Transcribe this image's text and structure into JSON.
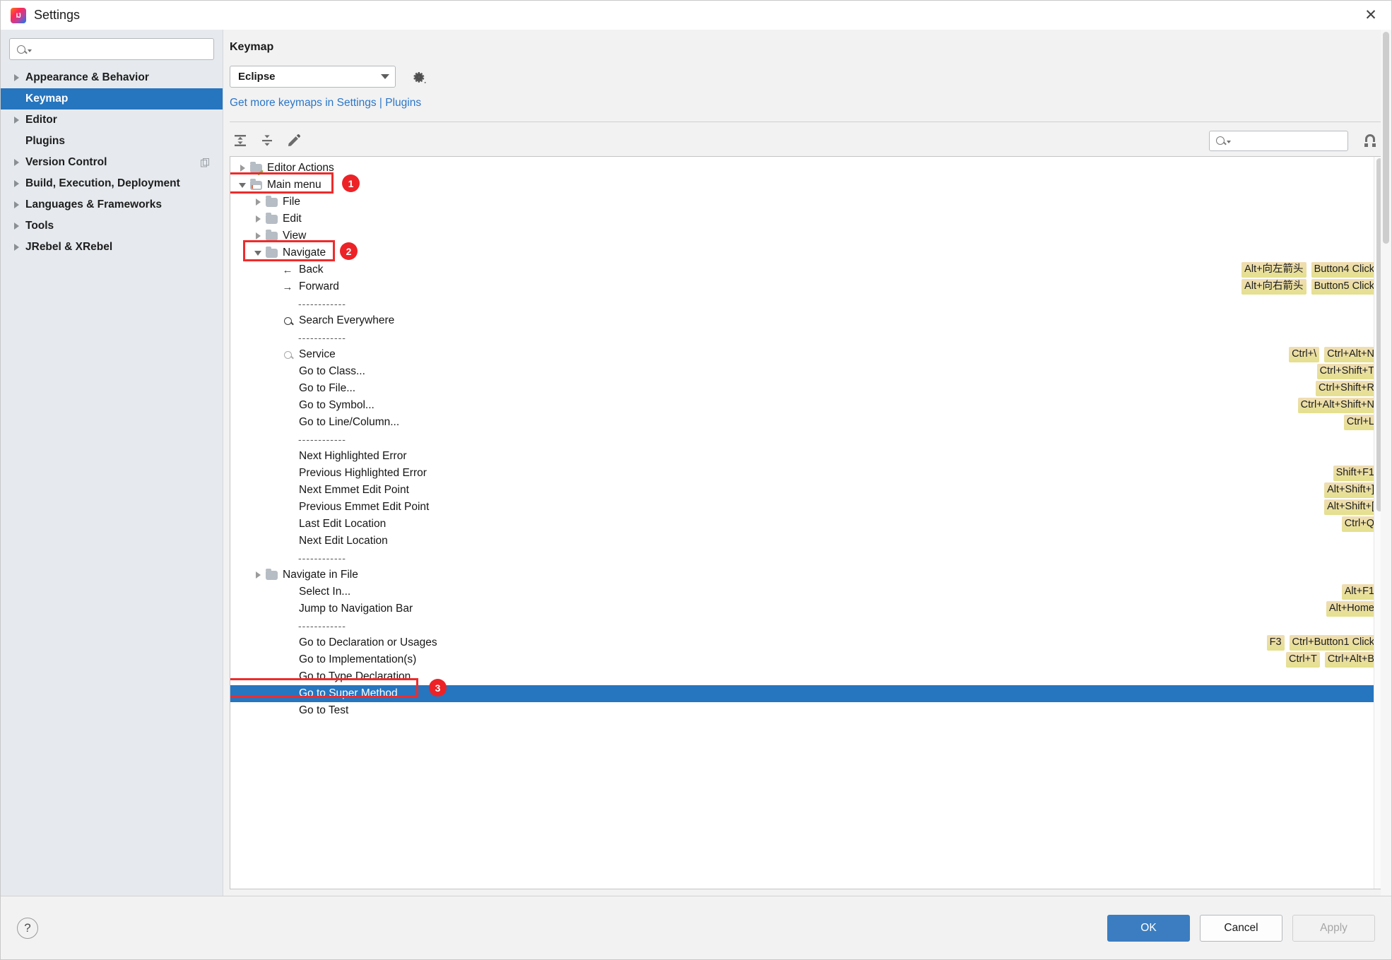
{
  "window": {
    "title": "Settings",
    "logo_icon": "intellij-idea-logo",
    "close_icon": "close-icon"
  },
  "sidebar": {
    "search": {
      "placeholder": "",
      "value": "",
      "icon": "search-icon"
    },
    "items": [
      {
        "label": "Appearance & Behavior",
        "expandable": true,
        "selected": false,
        "extra_icon": ""
      },
      {
        "label": "Keymap",
        "expandable": false,
        "selected": true,
        "extra_icon": ""
      },
      {
        "label": "Editor",
        "expandable": true,
        "selected": false,
        "extra_icon": ""
      },
      {
        "label": "Plugins",
        "expandable": false,
        "selected": false,
        "extra_icon": ""
      },
      {
        "label": "Version Control",
        "expandable": true,
        "selected": false,
        "extra_icon": "copy-icon"
      },
      {
        "label": "Build, Execution, Deployment",
        "expandable": true,
        "selected": false,
        "extra_icon": ""
      },
      {
        "label": "Languages & Frameworks",
        "expandable": true,
        "selected": false,
        "extra_icon": ""
      },
      {
        "label": "Tools",
        "expandable": true,
        "selected": false,
        "extra_icon": ""
      },
      {
        "label": "JRebel & XRebel",
        "expandable": true,
        "selected": false,
        "extra_icon": ""
      }
    ]
  },
  "main": {
    "title": "Keymap",
    "keymap_select": {
      "value": "Eclipse",
      "icon": "chevron-down-icon"
    },
    "gear_icon": "gear-icon",
    "link": "Get more keymaps in Settings | Plugins",
    "toolbar": {
      "expand_all_icon": "expand-all-icon",
      "collapse_all_icon": "collapse-all-icon",
      "edit_shortcut_icon": "pencil-edit-icon",
      "search": {
        "placeholder": "",
        "value": "",
        "icon": "search-icon"
      },
      "find_actions_by_shortcut_icon": "find-by-shortcut-icon"
    }
  },
  "tree": {
    "rows": [
      {
        "indent": 0,
        "twisty": "right",
        "icon": "folder-editor",
        "label": "Editor Actions",
        "shortcuts": []
      },
      {
        "indent": 0,
        "twisty": "down",
        "icon": "folder-mainmenu",
        "label": "Main menu",
        "shortcuts": [],
        "annotated": 1
      },
      {
        "indent": 1,
        "twisty": "right",
        "icon": "folder",
        "label": "File",
        "shortcuts": []
      },
      {
        "indent": 1,
        "twisty": "right",
        "icon": "folder",
        "label": "Edit",
        "shortcuts": []
      },
      {
        "indent": 1,
        "twisty": "right",
        "icon": "folder",
        "label": "View",
        "shortcuts": []
      },
      {
        "indent": 1,
        "twisty": "down",
        "icon": "folder",
        "label": "Navigate",
        "shortcuts": [],
        "annotated": 2
      },
      {
        "indent": 2,
        "twisty": "none",
        "icon": "arrow-left",
        "label": "Back",
        "shortcuts": [
          "Alt+向左箭头",
          "Button4 Click"
        ]
      },
      {
        "indent": 2,
        "twisty": "none",
        "icon": "arrow-right",
        "label": "Forward",
        "shortcuts": [
          "Alt+向右箭头",
          "Button5 Click"
        ]
      },
      {
        "indent": 2,
        "twisty": "none",
        "icon": "separator",
        "label": "------------",
        "shortcuts": []
      },
      {
        "indent": 2,
        "twisty": "none",
        "icon": "magnifier-dark",
        "label": "Search Everywhere",
        "shortcuts": []
      },
      {
        "indent": 2,
        "twisty": "none",
        "icon": "separator",
        "label": "------------",
        "shortcuts": []
      },
      {
        "indent": 2,
        "twisty": "none",
        "icon": "magnifier-light",
        "label": "Service",
        "shortcuts": [
          "Ctrl+\\",
          "Ctrl+Alt+N"
        ]
      },
      {
        "indent": 2,
        "twisty": "none",
        "icon": "none",
        "label": "Go to Class...",
        "shortcuts": [
          "Ctrl+Shift+T"
        ]
      },
      {
        "indent": 2,
        "twisty": "none",
        "icon": "none",
        "label": "Go to File...",
        "shortcuts": [
          "Ctrl+Shift+R"
        ]
      },
      {
        "indent": 2,
        "twisty": "none",
        "icon": "none",
        "label": "Go to Symbol...",
        "shortcuts": [
          "Ctrl+Alt+Shift+N"
        ]
      },
      {
        "indent": 2,
        "twisty": "none",
        "icon": "none",
        "label": "Go to Line/Column...",
        "shortcuts": [
          "Ctrl+L"
        ]
      },
      {
        "indent": 2,
        "twisty": "none",
        "icon": "separator",
        "label": "------------",
        "shortcuts": []
      },
      {
        "indent": 2,
        "twisty": "none",
        "icon": "none",
        "label": "Next Highlighted Error",
        "shortcuts": []
      },
      {
        "indent": 2,
        "twisty": "none",
        "icon": "none",
        "label": "Previous Highlighted Error",
        "shortcuts": [
          "Shift+F1"
        ]
      },
      {
        "indent": 2,
        "twisty": "none",
        "icon": "none",
        "label": "Next Emmet Edit Point",
        "shortcuts": [
          "Alt+Shift+]"
        ]
      },
      {
        "indent": 2,
        "twisty": "none",
        "icon": "none",
        "label": "Previous Emmet Edit Point",
        "shortcuts": [
          "Alt+Shift+["
        ]
      },
      {
        "indent": 2,
        "twisty": "none",
        "icon": "none",
        "label": "Last Edit Location",
        "shortcuts": [
          "Ctrl+Q"
        ]
      },
      {
        "indent": 2,
        "twisty": "none",
        "icon": "none",
        "label": "Next Edit Location",
        "shortcuts": []
      },
      {
        "indent": 2,
        "twisty": "none",
        "icon": "separator",
        "label": "------------",
        "shortcuts": []
      },
      {
        "indent": 1,
        "twisty": "right",
        "icon": "folder",
        "label": "Navigate in File",
        "shortcuts": []
      },
      {
        "indent": 2,
        "twisty": "none",
        "icon": "none",
        "label": "Select In...",
        "shortcuts": [
          "Alt+F1"
        ]
      },
      {
        "indent": 2,
        "twisty": "none",
        "icon": "none",
        "label": "Jump to Navigation Bar",
        "shortcuts": [
          "Alt+Home"
        ]
      },
      {
        "indent": 2,
        "twisty": "none",
        "icon": "separator",
        "label": "------------",
        "shortcuts": []
      },
      {
        "indent": 2,
        "twisty": "none",
        "icon": "none",
        "label": "Go to Declaration or Usages",
        "shortcuts": [
          "F3",
          "Ctrl+Button1 Click"
        ]
      },
      {
        "indent": 2,
        "twisty": "none",
        "icon": "none",
        "label": "Go to Implementation(s)",
        "shortcuts": [
          "Ctrl+T",
          "Ctrl+Alt+B"
        ]
      },
      {
        "indent": 2,
        "twisty": "none",
        "icon": "none",
        "label": "Go to Type Declaration",
        "shortcuts": []
      },
      {
        "indent": 2,
        "twisty": "none",
        "icon": "none",
        "label": "Go to Super Method",
        "shortcuts": [],
        "selected": true,
        "annotated": 3
      },
      {
        "indent": 2,
        "twisty": "none",
        "icon": "none",
        "label": "Go to Test",
        "shortcuts": []
      }
    ]
  },
  "footer": {
    "help_label": "?",
    "ok_label": "OK",
    "cancel_label": "Cancel",
    "apply_label": "Apply"
  }
}
